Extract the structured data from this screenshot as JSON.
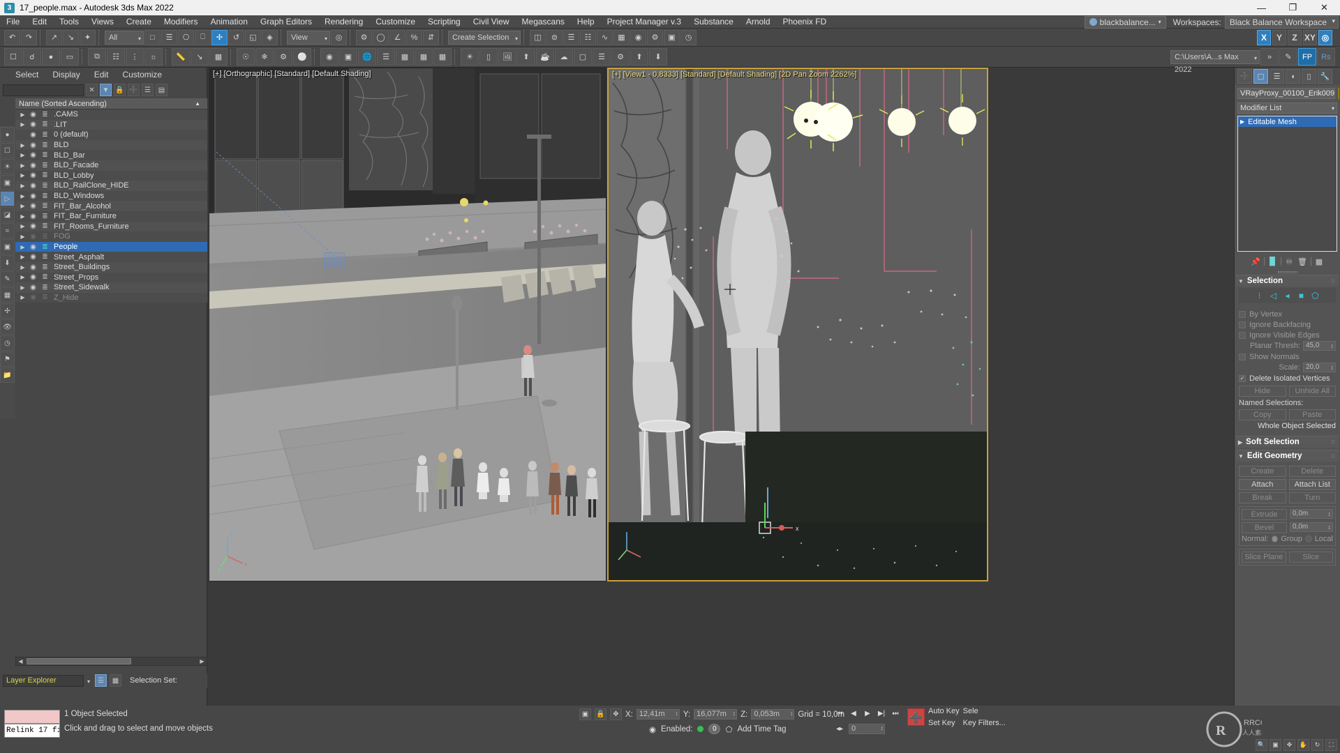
{
  "titlebar": {
    "title": "17_people.max - Autodesk 3ds Max 2022",
    "app_icon": "3dsmax-icon",
    "minimize": "—",
    "maximize": "❐",
    "close": "✕"
  },
  "menubar": {
    "items": [
      "File",
      "Edit",
      "Tools",
      "Views",
      "Create",
      "Modifiers",
      "Animation",
      "Graph Editors",
      "Rendering",
      "Customize",
      "Scripting",
      "Civil View",
      "Megascans",
      "Help",
      "Project Manager v.3",
      "Substance",
      "Arnold",
      "Phoenix FD"
    ],
    "user": "blackbalance...",
    "workspaces_label": "Workspaces:",
    "workspace_value": "Black Balance Workspace"
  },
  "toolbar_main": {
    "selection_filter": "All",
    "ref_coord_system": "View",
    "selection_set_placeholder": "Create Selection Se",
    "axis_keys": [
      "X",
      "Y",
      "Z",
      "XY"
    ],
    "project_path": "C:\\Users\\A...s Max 2022"
  },
  "layer_explorer": {
    "menu": [
      "Select",
      "Display",
      "Edit",
      "Customize"
    ],
    "search_value": "",
    "column_header": "Name (Sorted Ascending)",
    "rows": [
      {
        "name": ".CAMS",
        "expand": true,
        "hidden": false,
        "selected": false
      },
      {
        "name": ".LIT",
        "expand": true,
        "hidden": false,
        "selected": false
      },
      {
        "name": "0 (default)",
        "expand": false,
        "hidden": false,
        "selected": false
      },
      {
        "name": "BLD",
        "expand": true,
        "hidden": false,
        "selected": false
      },
      {
        "name": "BLD_Bar",
        "expand": true,
        "hidden": false,
        "selected": false
      },
      {
        "name": "BLD_Facade",
        "expand": true,
        "hidden": false,
        "selected": false
      },
      {
        "name": "BLD_Lobby",
        "expand": true,
        "hidden": false,
        "selected": false
      },
      {
        "name": "BLD_RailClone_HIDE",
        "expand": true,
        "hidden": false,
        "selected": false
      },
      {
        "name": "BLD_Windows",
        "expand": true,
        "hidden": false,
        "selected": false
      },
      {
        "name": "FIT_Bar_Alcohol",
        "expand": true,
        "hidden": false,
        "selected": false
      },
      {
        "name": "FIT_Bar_Furniture",
        "expand": true,
        "hidden": false,
        "selected": false
      },
      {
        "name": "FIT_Rooms_Furniture",
        "expand": true,
        "hidden": false,
        "selected": false
      },
      {
        "name": "FOG",
        "expand": true,
        "hidden": true,
        "selected": false
      },
      {
        "name": "People",
        "expand": true,
        "hidden": false,
        "selected": true
      },
      {
        "name": "Street_Asphalt",
        "expand": true,
        "hidden": false,
        "selected": false
      },
      {
        "name": "Street_Buildings",
        "expand": true,
        "hidden": false,
        "selected": false
      },
      {
        "name": "Street_Props",
        "expand": true,
        "hidden": false,
        "selected": false
      },
      {
        "name": "Street_Sidewalk",
        "expand": true,
        "hidden": false,
        "selected": false
      },
      {
        "name": "Z_Hide",
        "expand": true,
        "hidden": true,
        "selected": false
      }
    ],
    "footer_combo": "Layer Explorer",
    "selection_set_label": "Selection Set:"
  },
  "viewports": {
    "left": {
      "label": "[+] [Orthographic] [Standard] [Default Shading]",
      "active": false
    },
    "right": {
      "label": "[+] [View1 - 0,8333] [Standard] [Default Shading] [2D Pan Zoom 2262%]",
      "active": true
    }
  },
  "command_panel": {
    "tabs": [
      "create-tab",
      "modify-tab",
      "hierarchy-tab",
      "motion-tab",
      "display-tab",
      "utilities-tab"
    ],
    "active_tab_index": 1,
    "object_name": "VRayProxy_00100_Erik009",
    "object_color": "#d6bb2e",
    "modifier_list_label": "Modifier List",
    "stack": [
      {
        "label": "Editable Mesh",
        "selected": true
      }
    ],
    "rollouts": [
      {
        "title": "Selection",
        "open": true,
        "sublevel_icons": [
          "vertex",
          "edge",
          "face",
          "polygon",
          "element"
        ],
        "checkboxes": [
          {
            "label": "By Vertex",
            "checked": false,
            "enabled": false
          },
          {
            "label": "Ignore Backfacing",
            "checked": false,
            "enabled": false
          },
          {
            "label": "Ignore Visible Edges",
            "checked": false,
            "enabled": false
          },
          {
            "label": "Show Normals",
            "checked": false,
            "enabled": false
          },
          {
            "label": "Delete Isolated Vertices",
            "checked": true,
            "enabled": false
          }
        ],
        "spinners": [
          {
            "label": "Planar Thresh:",
            "value": "45,0"
          },
          {
            "label": "Scale:",
            "value": "20,0"
          }
        ],
        "buttons": [
          "Hide",
          "Unhide All",
          "Copy",
          "Paste"
        ],
        "named_selections_label": "Named Selections:",
        "status": "Whole Object Selected"
      },
      {
        "title": "Soft Selection",
        "open": false
      },
      {
        "title": "Edit Geometry",
        "open": true,
        "buttons": [
          "Create",
          "Delete",
          "Attach",
          "Attach List",
          "Break",
          "Turn",
          "Slice Plane",
          "Slice"
        ],
        "extrude_label": "Extrude",
        "extrude_value": "0,0m",
        "bevel_label": "Bevel",
        "bevel_value": "0,0m",
        "normal_label": "Normal:",
        "normal_options": [
          "Group",
          "Local"
        ],
        "normal_selected": "Group"
      }
    ]
  },
  "statusbar": {
    "listener_text": "Relink 17 fi",
    "selection_status": "1 Object Selected",
    "prompt": "Click and drag to select and move objects",
    "coords": {
      "x_label": "X:",
      "x_value": "12,41m",
      "y_label": "Y:",
      "y_value": "16,077m",
      "z_label": "Z:",
      "z_value": "0,053m",
      "grid": "Grid = 10,0m"
    },
    "enabled_label": "Enabled:",
    "enabled_frame": "0",
    "time_tag": "Add Time Tag",
    "auto_key": "Auto Key",
    "set_key": "Set Key",
    "selected_label": "Sele",
    "key_filters": "Key Filters...",
    "frame_value": "0"
  }
}
